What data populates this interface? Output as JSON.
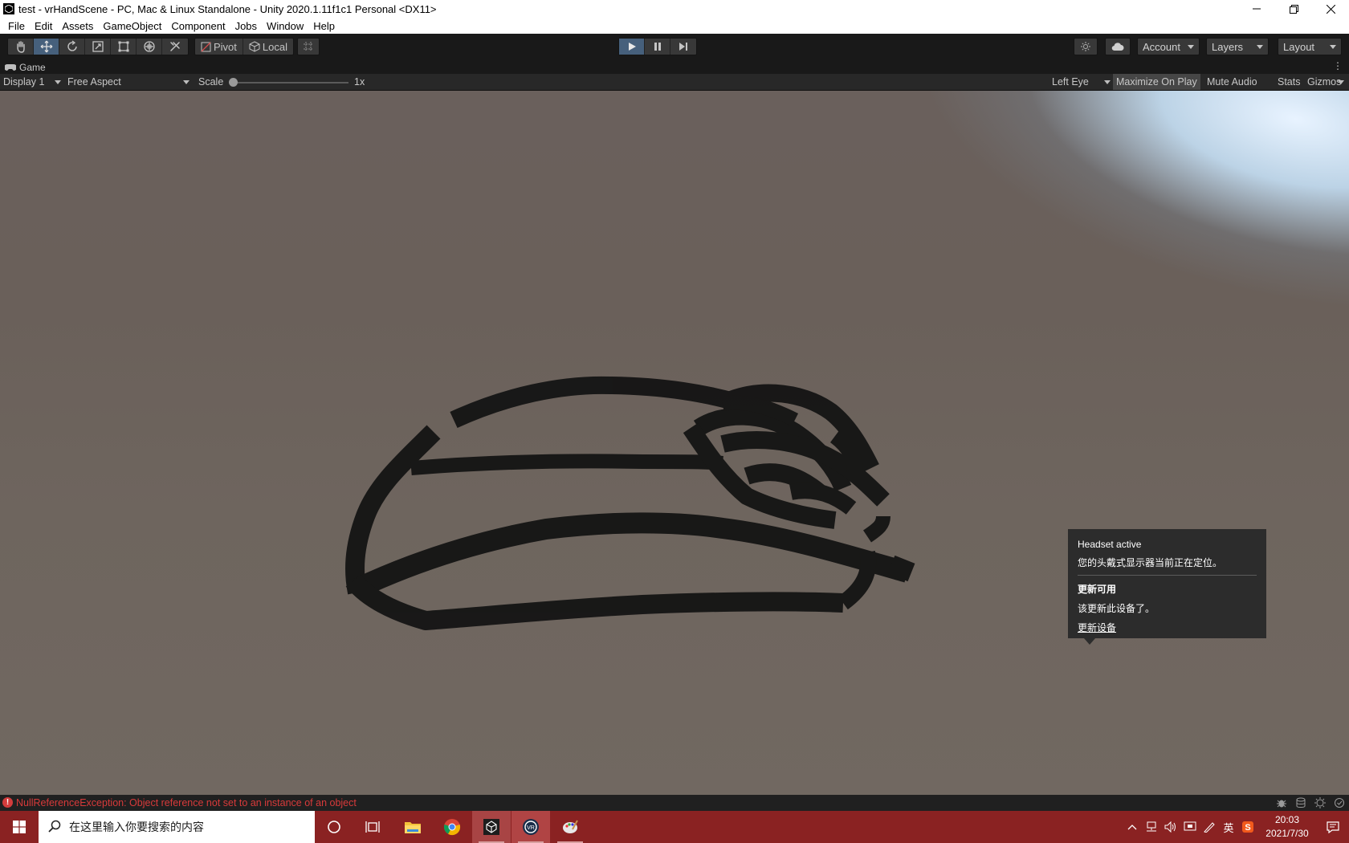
{
  "window": {
    "title": "test - vrHandScene - PC, Mac & Linux Standalone - Unity 2020.1.11f1c1 Personal <DX11>",
    "minimize_icon": "minimize-icon",
    "restore_icon": "restore-icon",
    "close_icon": "close-icon"
  },
  "menu": [
    "File",
    "Edit",
    "Assets",
    "GameObject",
    "Component",
    "Jobs",
    "Window",
    "Help"
  ],
  "toolbar": {
    "tools": [
      "hand-tool-icon",
      "move-tool-icon",
      "rotate-tool-icon",
      "scale-tool-icon",
      "rect-tool-icon",
      "transform-tool-icon",
      "custom-tool-icon"
    ],
    "active_tool": "move-tool-icon",
    "pivot_label": "Pivot",
    "local_label": "Local",
    "account_label": "Account",
    "layers_label": "Layers",
    "layout_label": "Layout",
    "play_state": "playing",
    "accent_color": "#46607c"
  },
  "game_view": {
    "tab_label": "Game",
    "display": "Display 1",
    "aspect": "Free Aspect",
    "scale_label": "Scale",
    "scale_value": "1x",
    "eye": "Left Eye",
    "maximize_label": "Maximize On Play",
    "mute_label": "Mute Audio",
    "stats_label": "Stats",
    "gizmos_label": "Gizmos"
  },
  "popup": {
    "headline": "Headset active",
    "headline_detail": "您的头戴式显示器当前正在定位。",
    "update_title": "更新可用",
    "update_detail": "该更新此设备了。",
    "update_link": "更新设备"
  },
  "status": {
    "error_text": "NullReferenceException: Object reference not set to an instance of an object",
    "error_color": "#d83a3a"
  },
  "taskbar": {
    "search_placeholder": "在这里输入你要搜索的内容",
    "ime_label": "英",
    "time": "20:03",
    "date": "2021/7/30",
    "color": "#8a2222"
  }
}
